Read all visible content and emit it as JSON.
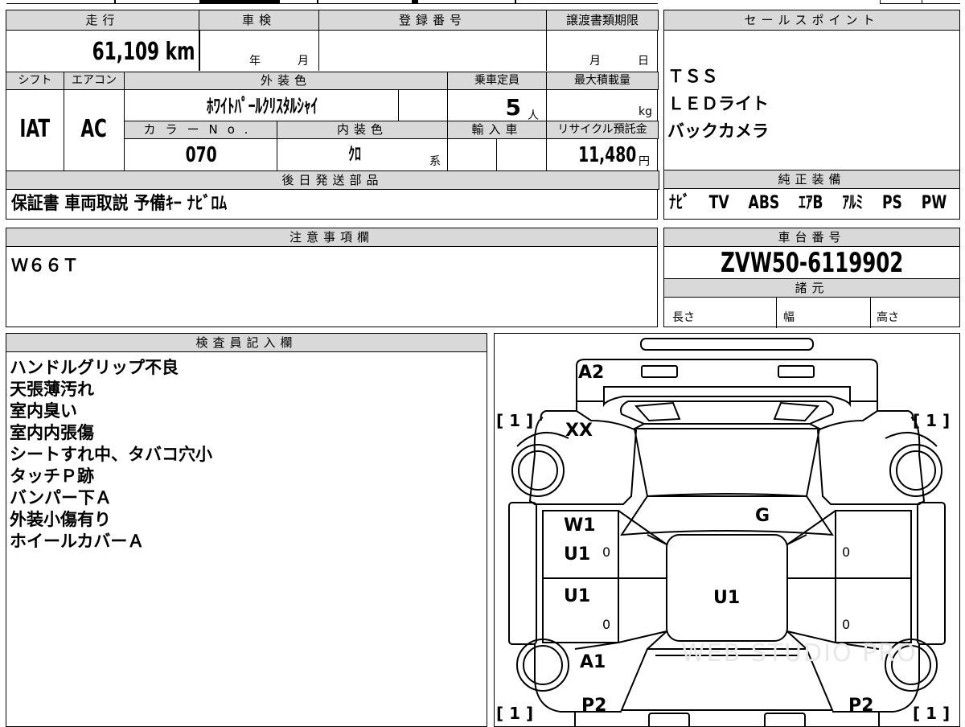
{
  "vehicle_info": {
    "mileage_label": "走行",
    "mileage_value": "61,109",
    "mileage_unit": "km",
    "shaken_label": "車検",
    "shaken_year": "年",
    "shaken_month": "月",
    "registration_label": "登録番号",
    "transfer_deadline_label": "譲渡書類期限",
    "transfer_month": "月",
    "transfer_day": "日",
    "shift_label": "シフト",
    "shift_value": "IAT",
    "ac_label": "エアコン",
    "ac_value": "AC",
    "exterior_color_label": "外装色",
    "exterior_color_value": "ﾎﾜｲﾄﾊﾟｰﾙｸﾘｽﾀﾙｼｬｲ",
    "capacity_label": "乗車定員",
    "capacity_value": "5",
    "capacity_unit": "人",
    "max_load_label": "最大積載量",
    "max_load_unit": "kg",
    "color_no_label": "カラーNo.",
    "color_no_value": "070",
    "interior_color_label": "内装色",
    "interior_color_value": "ｸﾛ",
    "interior_color_suffix": "系",
    "import_label": "輸入車",
    "recycle_label": "リサイクル預託金",
    "recycle_value": "11,480",
    "recycle_unit": "円"
  },
  "later_parts": {
    "label": "後日発送部品",
    "value": "保証書 車両取説 予備ｷｰ ﾅﾋﾞﾛﾑ"
  },
  "sales_points": {
    "label": "セールスポイント",
    "items": [
      "ＴＳＳ",
      "ＬＥＤライト",
      "バックカメラ"
    ]
  },
  "genuine_equipment": {
    "label": "純正装備",
    "items": [
      "ﾅﾋﾞ",
      "TV",
      "ABS",
      "ｴｱB",
      "ｱﾙﾐ",
      "PS",
      "PW"
    ]
  },
  "notes": {
    "label": "注意事項欄",
    "value": "Ｗ６６Ｔ"
  },
  "chassis": {
    "label": "車台番号",
    "value": "ZVW50-6119902",
    "spec_label": "諸元",
    "length_label": "長さ",
    "width_label": "幅",
    "height_label": "高さ"
  },
  "inspector": {
    "label": "検査員記入欄",
    "lines": [
      "ハンドルグリップ不良",
      "天張薄汚れ",
      "室内臭い",
      "室内内張傷",
      "シートすれ中、タバコ穴小",
      "タッチＰ跡",
      "バンパー下Ａ",
      "外装小傷有り",
      "ホイールカバーＡ"
    ]
  },
  "diagram": {
    "marks": {
      "a2": "A2",
      "xx": "XX",
      "g": "G",
      "w1": "W1",
      "u1_front_left": "U1",
      "u1_rear_left": "U1",
      "u1_center": "U1",
      "a1": "A1",
      "p2_left": "P2",
      "p2_right": "P2",
      "zero_1": "0",
      "zero_2": "0",
      "zero_3": "0",
      "zero_4": "0"
    },
    "tire_counts": {
      "front_left": "[ 1 ]",
      "front_right": "[ 1 ]",
      "rear_left": "[ 1 ]",
      "rear_right": "[ 1 ]"
    },
    "watermark": "WEB STUDIO PRO"
  }
}
